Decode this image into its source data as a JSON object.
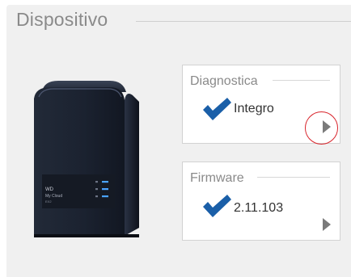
{
  "section": {
    "title": "Dispositivo"
  },
  "device": {
    "icon": "nas-device-icon",
    "brand_line1": "WD",
    "brand_line2": "My Cloud",
    "brand_line3": "EX2"
  },
  "cards": {
    "diagnostics": {
      "title": "Diagnostica",
      "value": "Integro",
      "status_icon": "checkmark-icon",
      "nav_icon": "chevron-right-icon"
    },
    "firmware": {
      "title": "Firmware",
      "value": "2.11.103",
      "status_icon": "checkmark-icon",
      "nav_icon": "chevron-right-icon"
    }
  },
  "colors": {
    "check": "#1a5fa8",
    "arrow": "#7a7a7a",
    "highlight": "#d8232a",
    "panel_bg": "#f0f0f0"
  }
}
